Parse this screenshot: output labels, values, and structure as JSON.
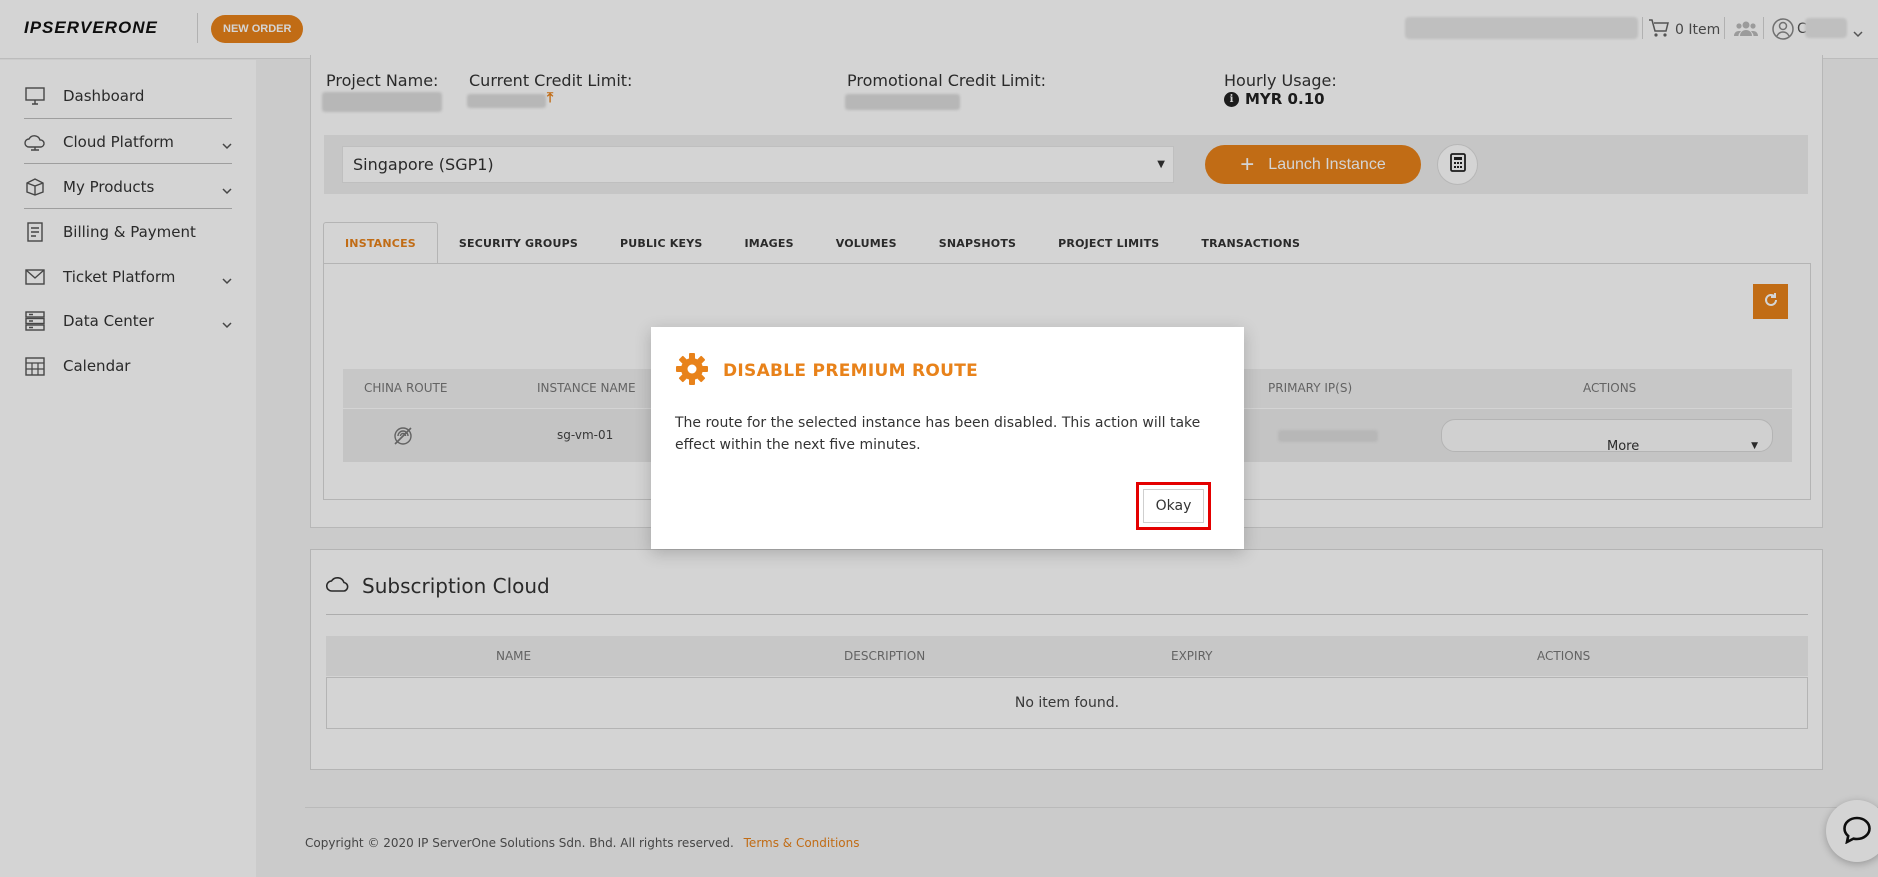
{
  "header": {
    "logo_text": "IPSERVERONE",
    "new_order_label": "NEW ORDER",
    "cart_label": "0 Item",
    "user_label": "C"
  },
  "sidebar": {
    "items": [
      {
        "label": "Dashboard",
        "icon": "monitor-icon",
        "has_children": false
      },
      {
        "label": "Cloud Platform",
        "icon": "cloud-icon",
        "has_children": true
      },
      {
        "label": "My Products",
        "icon": "box-icon",
        "has_children": true
      },
      {
        "label": "Billing & Payment",
        "icon": "billing-icon",
        "has_children": false
      },
      {
        "label": "Ticket Platform",
        "icon": "envelope-icon",
        "has_children": true
      },
      {
        "label": "Data Center",
        "icon": "server-icon",
        "has_children": true
      },
      {
        "label": "Calendar",
        "icon": "calendar-icon",
        "has_children": false
      }
    ]
  },
  "project": {
    "project_name_label": "Project Name:",
    "current_credit_label": "Current Credit Limit:",
    "promo_credit_label": "Promotional Credit Limit:",
    "hourly_usage_label": "Hourly Usage:",
    "hourly_usage_value": "MYR 0.10"
  },
  "region": {
    "selected": "Singapore (SGP1)",
    "launch_label": "Launch Instance"
  },
  "tabs": [
    {
      "label": "INSTANCES",
      "active": true
    },
    {
      "label": "SECURITY GROUPS",
      "active": false
    },
    {
      "label": "PUBLIC KEYS",
      "active": false
    },
    {
      "label": "IMAGES",
      "active": false
    },
    {
      "label": "VOLUMES",
      "active": false
    },
    {
      "label": "SNAPSHOTS",
      "active": false
    },
    {
      "label": "PROJECT LIMITS",
      "active": false
    },
    {
      "label": "TRANSACTIONS",
      "active": false
    }
  ],
  "instances": {
    "columns": [
      "CHINA ROUTE",
      "INSTANCE NAME",
      "PRIMARY IP(S)",
      "ACTIONS"
    ],
    "rows": [
      {
        "name": "sg-vm-01",
        "action": "More"
      }
    ]
  },
  "subscription": {
    "title": "Subscription Cloud",
    "columns": [
      "NAME",
      "DESCRIPTION",
      "EXPIRY",
      "ACTIONS"
    ],
    "empty_text": "No item found."
  },
  "footer": {
    "copyright": "Copyright © 2020 IP ServerOne Solutions Sdn. Bhd. All rights reserved.",
    "terms_label": "Terms & Conditions"
  },
  "modal": {
    "title": "DISABLE PREMIUM ROUTE",
    "message": "The route for the selected instance has been disabled. This action will take effect within the next five minutes.",
    "ok_label": "Okay"
  },
  "colors": {
    "accent": "#e8821a",
    "highlight_border": "#e40000"
  }
}
